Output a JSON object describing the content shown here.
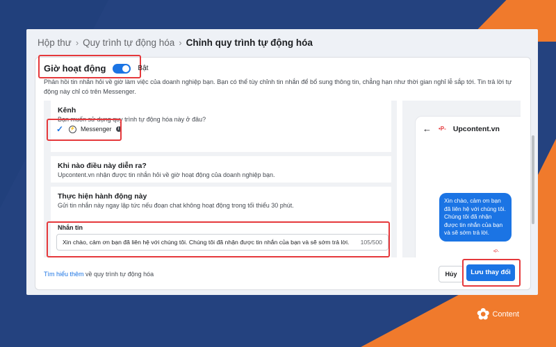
{
  "breadcrumb": {
    "items": [
      "Hộp thư",
      "Quy trình tự động hóa"
    ],
    "current": "Chỉnh quy trình tự động hóa"
  },
  "header": {
    "title": "Giờ hoạt động",
    "toggle_label": "Bật",
    "toggle_on": true,
    "description": "Phản hồi tin nhắn hỏi về giờ làm việc của doanh nghiệp bạn. Bạn có thể tùy chỉnh tin nhắn để bổ sung thông tin, chẳng hạn như thời gian nghỉ lễ sắp tới. Tin trả lời tự động này chỉ có trên Messenger."
  },
  "sections": {
    "channel": {
      "title": "Kênh",
      "subtitle": "Bạn muốn sử dụng quy trình tự động hóa này ở đâu?",
      "option_label": "Messenger",
      "checked": true
    },
    "trigger": {
      "title": "Khi nào điều này diễn ra?",
      "subtitle": "Upcontent.vn nhận được tin nhắn hỏi về giờ hoạt động của doanh nghiệp bạn."
    },
    "action": {
      "title": "Thực hiện hành động này",
      "subtitle": "Gửi tin nhắn này ngay lập tức nếu đoạn chat không hoạt động trong tối thiểu 30 phút.",
      "message_label": "Nhắn tin",
      "message_text": "Xin chào, cảm ơn bạn đã liên hệ với chúng tôi. Chúng tôi đã nhận được tin nhắn của bạn và sẽ sớm trả lời.",
      "counter": "105/500"
    }
  },
  "preview": {
    "page_name": "Upcontent.vn",
    "bubble_text": "Xin chào, cảm ơn bạn đã liên hệ với chúng tôi. Chúng tôi đã nhận được tin nhắn của bạn và sẽ sớm trả lời."
  },
  "footer": {
    "link_text": "Tìm hiểu thêm",
    "link_suffix": " về quy trình tự động hóa",
    "cancel_label": "Hủy",
    "save_label": "Lưu thay đổi"
  },
  "brand": {
    "name": "Content"
  },
  "colors": {
    "accent": "#1b74e4",
    "highlight": "#e5383b",
    "background_navy": "#24427f",
    "background_orange": "#f07a2c"
  }
}
